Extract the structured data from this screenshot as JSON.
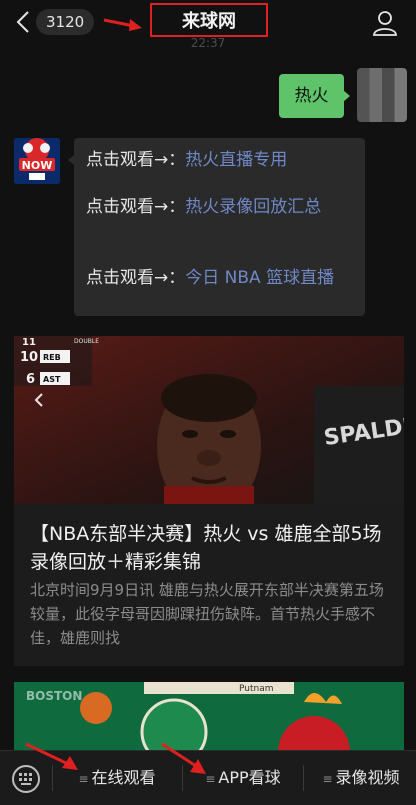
{
  "header": {
    "back_badge": "3120",
    "title": "来球网",
    "timestamp": "22:37"
  },
  "chat": {
    "user_message": "热火",
    "bot_menu": [
      {
        "prefix": "点击观看",
        "arrow": "→：",
        "link": "热火直播专用"
      },
      {
        "prefix": "点击观看",
        "arrow": "→：",
        "link": "热火录像回放汇总"
      },
      {
        "prefix": "点击观看",
        "arrow": "→：",
        "link": "今日 NBA 篮球直播"
      }
    ],
    "bot_avatar_text": "NOW"
  },
  "card": {
    "stats": [
      {
        "num": "11",
        "label": "DOUBLE"
      },
      {
        "num": "10",
        "label": "REB"
      },
      {
        "num": "6",
        "label": "AST"
      }
    ],
    "image_brand": "SPALDING",
    "title": "【NBA东部半决赛】热火 vs 雄鹿全部5场录像回放＋精彩集锦",
    "description": "北京时间9月9日讯 雄鹿与热火展开东部半决赛第五场较量，此役字母哥因脚踝扭伤缺阵。首节热火手感不佳，雄鹿则找"
  },
  "card2": {
    "image_text_left": "BOSTON",
    "image_text_right": "Putnam"
  },
  "bottom_menu": {
    "items": [
      "在线观看",
      "APP看球",
      "录像视频"
    ]
  },
  "colors": {
    "background": "#111111",
    "bubble_user": "#5fc36a",
    "bubble_bot": "#2a2a2a",
    "link": "#6f88c6",
    "annotation_red": "#e02020"
  }
}
